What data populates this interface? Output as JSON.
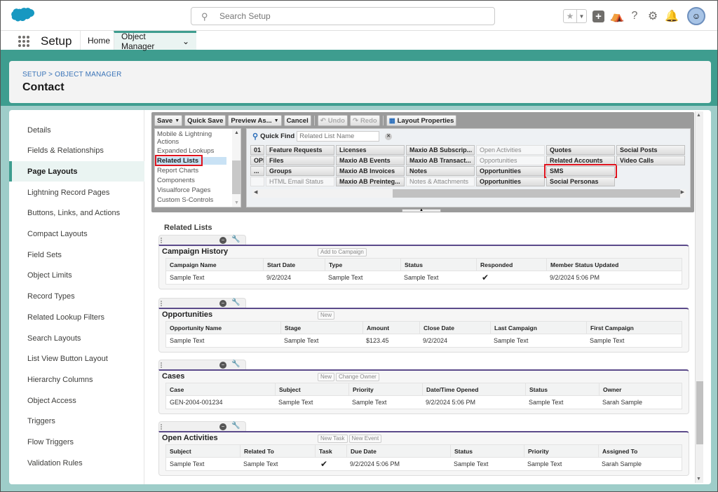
{
  "topbar": {
    "search_placeholder": "Search Setup",
    "icons": [
      "favorites-star-icon",
      "favorites-dropdown-icon",
      "global-actions-plus-icon",
      "trailhead-icon",
      "help-icon",
      "gear-icon",
      "notification-bell-icon",
      "avatar"
    ]
  },
  "nav": {
    "app_name": "Setup",
    "tabs": [
      {
        "label": "Home",
        "active": false
      },
      {
        "label": "Object Manager",
        "active": true,
        "chevron": "⌄"
      }
    ]
  },
  "header": {
    "breadcrumb": "SETUP > OBJECT MANAGER",
    "title": "Contact"
  },
  "sidebar": {
    "items": [
      {
        "label": "Details"
      },
      {
        "label": "Fields & Relationships"
      },
      {
        "label": "Page Layouts",
        "active": true
      },
      {
        "label": "Lightning Record Pages"
      },
      {
        "label": "Buttons, Links, and Actions"
      },
      {
        "label": "Compact Layouts"
      },
      {
        "label": "Field Sets"
      },
      {
        "label": "Object Limits"
      },
      {
        "label": "Record Types"
      },
      {
        "label": "Related Lookup Filters"
      },
      {
        "label": "Search Layouts"
      },
      {
        "label": "List View Button Layout"
      },
      {
        "label": "Hierarchy Columns"
      },
      {
        "label": "Object Access"
      },
      {
        "label": "Triggers"
      },
      {
        "label": "Flow Triggers"
      },
      {
        "label": "Validation Rules"
      }
    ]
  },
  "toolbar": {
    "save": "Save",
    "quick_save": "Quick Save",
    "preview_as": "Preview As...",
    "cancel": "Cancel",
    "undo": "Undo",
    "redo": "Redo",
    "layout_properties": "Layout Properties"
  },
  "palette": {
    "categories": [
      {
        "label": "Mobile & Lightning Actions"
      },
      {
        "label": "Expanded Lookups"
      },
      {
        "label": "Related Lists",
        "selected": true
      },
      {
        "label": "Report Charts"
      },
      {
        "label": "Components"
      },
      {
        "label": "Visualforce Pages"
      },
      {
        "label": "Custom S-Controls"
      }
    ],
    "quick_find_label": "Quick Find",
    "quick_find_placeholder": "Related List Name",
    "columns": [
      [
        {
          "label": "01"
        },
        {
          "label": "OPE..."
        },
        {
          "label": "..."
        },
        {
          "label": "",
          "used": true
        }
      ],
      [
        {
          "label": "Feature Requests"
        },
        {
          "label": "Files"
        },
        {
          "label": "Groups"
        },
        {
          "label": "HTML Email Status",
          "used": true
        }
      ],
      [
        {
          "label": "Licenses"
        },
        {
          "label": "Maxio AB Events"
        },
        {
          "label": "Maxio AB Invoices"
        },
        {
          "label": "Maxio AB Preinteg..."
        }
      ],
      [
        {
          "label": "Maxio AB Subscrip..."
        },
        {
          "label": "Maxio AB Transact..."
        },
        {
          "label": "Notes"
        },
        {
          "label": "Notes & Attachments",
          "used": true
        }
      ],
      [
        {
          "label": "Open Activities",
          "used": true
        },
        {
          "label": "Opportunities",
          "used": true
        },
        {
          "label": "Opportunities"
        },
        {
          "label": "Opportunities"
        }
      ],
      [
        {
          "label": "Quotes"
        },
        {
          "label": "Related Accounts"
        },
        {
          "label": "SMS",
          "highlighted": true
        },
        {
          "label": "Social Personas"
        }
      ],
      [
        {
          "label": "Social Posts"
        },
        {
          "label": "Video Calls"
        }
      ]
    ]
  },
  "related_lists": {
    "section_title": "Related Lists",
    "lists": [
      {
        "name": "Campaign History",
        "buttons": [
          "Add to Campaign"
        ],
        "columns": [
          "Campaign Name",
          "Start Date",
          "Type",
          "Status",
          "Responded",
          "Member Status Updated"
        ],
        "row": [
          "Sample Text",
          "9/2/2024",
          "Sample Text",
          "Sample Text",
          "✔",
          "9/2/2024 5:06 PM"
        ]
      },
      {
        "name": "Opportunities",
        "buttons": [
          "New"
        ],
        "columns": [
          "Opportunity Name",
          "Stage",
          "Amount",
          "Close Date",
          "Last Campaign",
          "First Campaign"
        ],
        "row": [
          "Sample Text",
          "Sample Text",
          "$123.45",
          "9/2/2024",
          "Sample Text",
          "Sample Text"
        ]
      },
      {
        "name": "Cases",
        "buttons": [
          "New",
          "Change Owner"
        ],
        "columns": [
          "Case",
          "Subject",
          "Priority",
          "Date/Time Opened",
          "Status",
          "Owner"
        ],
        "row": [
          "GEN-2004-001234",
          "Sample Text",
          "Sample Text",
          "9/2/2024 5:06 PM",
          "Sample Text",
          "Sarah Sample"
        ]
      },
      {
        "name": "Open Activities",
        "buttons": [
          "New Task",
          "New Event"
        ],
        "columns": [
          "Subject",
          "Related To",
          "Task",
          "Due Date",
          "Status",
          "Priority",
          "Assigned To"
        ],
        "row": [
          "Sample Text",
          "Sample Text",
          "✔",
          "9/2/2024 5:06 PM",
          "Sample Text",
          "Sample Text",
          "Sarah Sample"
        ]
      }
    ]
  }
}
